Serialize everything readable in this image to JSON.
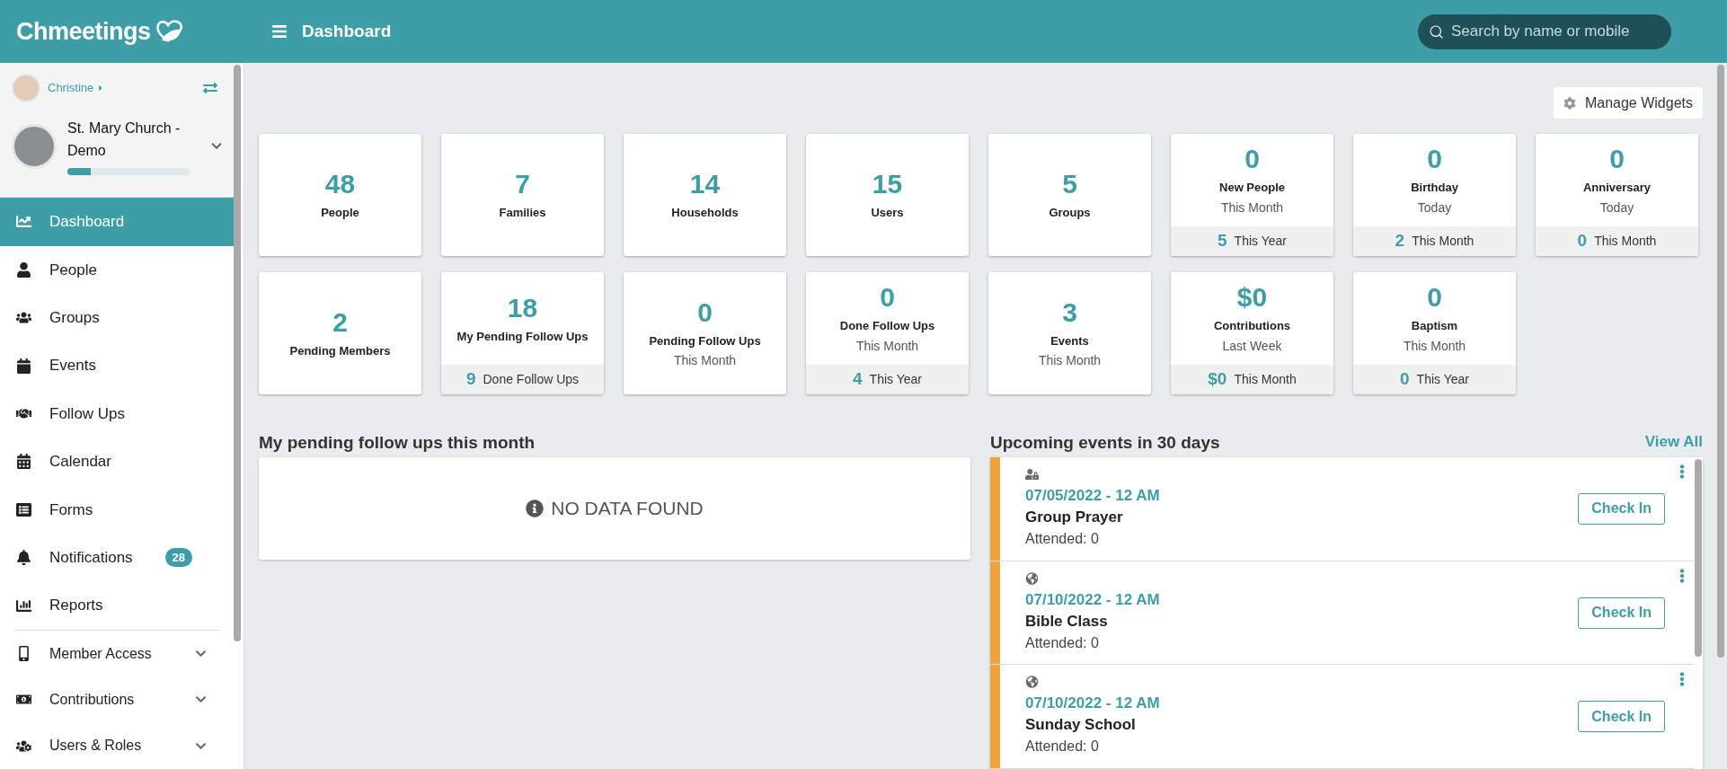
{
  "brand": {
    "name": "Chmeetings"
  },
  "header": {
    "title": "Dashboard",
    "search": {
      "placeholder": "Search by name or mobile"
    }
  },
  "sidebar": {
    "user": {
      "name": "Christine"
    },
    "church": {
      "name": "St. Mary Church - Demo",
      "level": 0.19
    },
    "items": [
      {
        "label": "Dashboard",
        "kind": "link",
        "selected": true
      },
      {
        "label": "People",
        "kind": "link",
        "selected": false
      },
      {
        "label": "Groups",
        "kind": "link",
        "selected": false
      },
      {
        "label": "Events",
        "kind": "link",
        "selected": false
      },
      {
        "label": "Follow Ups",
        "kind": "link",
        "selected": false
      },
      {
        "label": "Calendar",
        "kind": "link",
        "selected": false
      },
      {
        "label": "Forms",
        "kind": "link",
        "selected": false
      },
      {
        "label": "Notifications",
        "kind": "link",
        "selected": false,
        "badge": "28"
      },
      {
        "label": "Reports",
        "kind": "link",
        "selected": false
      },
      {
        "label": "Member Access",
        "kind": "group",
        "selected": false
      },
      {
        "label": "Contributions",
        "kind": "group",
        "selected": false
      },
      {
        "label": "Users & Roles",
        "kind": "group",
        "selected": false
      }
    ]
  },
  "manage_widgets": "Manage Widgets",
  "widgets": [
    {
      "value": "48",
      "label": "People"
    },
    {
      "value": "7",
      "label": "Families"
    },
    {
      "value": "14",
      "label": "Households"
    },
    {
      "value": "15",
      "label": "Users"
    },
    {
      "value": "5",
      "label": "Groups"
    },
    {
      "value": "0",
      "label": "New People",
      "sub": "This Month",
      "footer": {
        "value": "5",
        "text": "This Year"
      }
    },
    {
      "value": "0",
      "label": "Birthday",
      "sub": "Today",
      "footer": {
        "value": "2",
        "text": "This Month"
      }
    },
    {
      "value": "0",
      "label": "Anniversary",
      "sub": "Today",
      "footer": {
        "value": "0",
        "text": "This Month"
      }
    },
    {
      "value": "2",
      "label": "Pending Members"
    },
    {
      "value": "18",
      "label": "My Pending Follow Ups",
      "footer": {
        "value": "9",
        "text": "Done Follow Ups"
      }
    },
    {
      "value": "0",
      "label": "Pending Follow Ups",
      "sub": "This Month"
    },
    {
      "value": "0",
      "label": "Done Follow Ups",
      "sub": "This Month",
      "footer": {
        "value": "4",
        "text": "This Year"
      }
    },
    {
      "value": "3",
      "label": "Events",
      "sub": "This Month"
    },
    {
      "value": "$0",
      "label": "Contributions",
      "sub": "Last Week",
      "footer": {
        "value": "$0",
        "text": "This Month"
      }
    },
    {
      "value": "0",
      "label": "Baptism",
      "sub": "This Month",
      "footer": {
        "value": "0",
        "text": "This Year"
      }
    }
  ],
  "follow_ups": {
    "title": "My pending follow ups this month",
    "empty": "NO DATA FOUND"
  },
  "events": {
    "title": "Upcoming events in 30 days",
    "view_all": "View All",
    "items": [
      {
        "private": true,
        "date": "07/05/2022 - 12 AM",
        "name": "Group Prayer",
        "attended": "Attended: 0",
        "action": "Check In"
      },
      {
        "private": false,
        "date": "07/10/2022 - 12 AM",
        "name": "Bible Class",
        "attended": "Attended: 0",
        "action": "Check In"
      },
      {
        "private": false,
        "date": "07/10/2022 - 12 AM",
        "name": "Sunday School",
        "attended": "Attended: 0",
        "action": "Check In"
      }
    ]
  }
}
